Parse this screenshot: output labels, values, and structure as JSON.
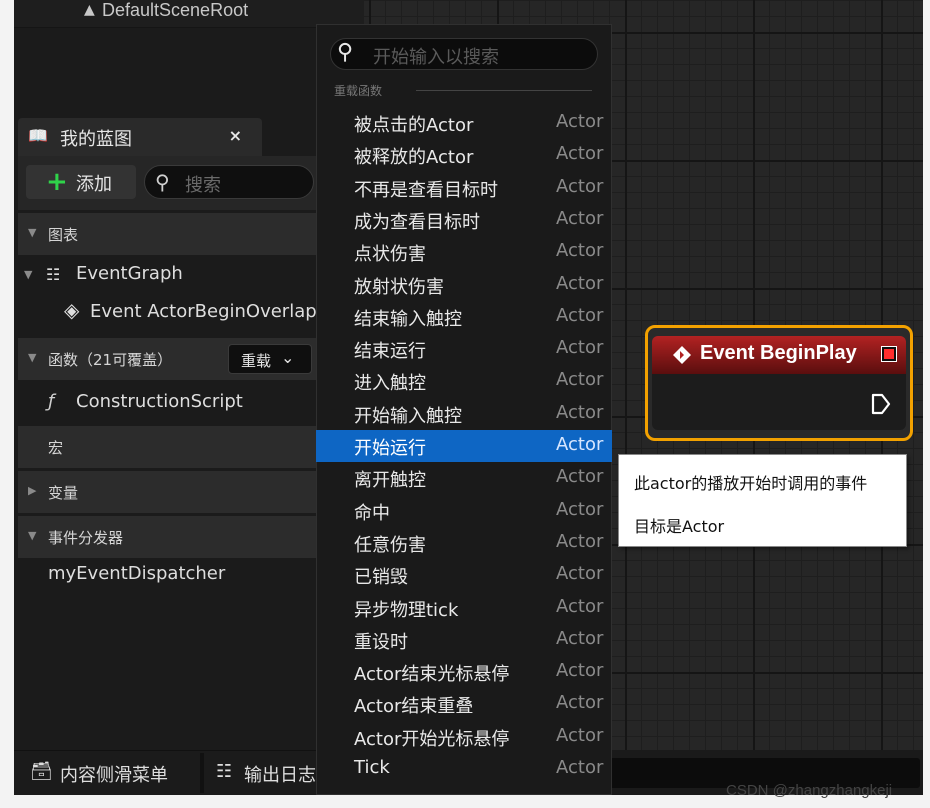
{
  "scene": {
    "root_label": "DefaultSceneRoot"
  },
  "blueprint_panel": {
    "tab_title": "我的蓝图",
    "tab_close": "×",
    "add_label": "添加",
    "search_placeholder": "搜索",
    "sections": {
      "graphs": "图表",
      "functions": "函数（21可覆盖）",
      "macros": "宏",
      "variables": "变量",
      "dispatchers": "事件分发器"
    },
    "event_graph": "EventGraph",
    "event_overlap": "Event ActorBeginOverlap",
    "reload_label": "重载",
    "construction_script": "ConstructionScript",
    "dispatcher_item": "myEventDispatcher"
  },
  "bottom_bar": {
    "content_drawer": "内容侧滑菜单",
    "output_log": "输出日志"
  },
  "context_menu": {
    "search_placeholder": "开始输入以搜索",
    "category": "重载函数",
    "selected_index": 10,
    "items": [
      {
        "name": "被点击的Actor",
        "class": "Actor"
      },
      {
        "name": "被释放的Actor",
        "class": "Actor"
      },
      {
        "name": "不再是查看目标时",
        "class": "Actor"
      },
      {
        "name": "成为查看目标时",
        "class": "Actor"
      },
      {
        "name": "点状伤害",
        "class": "Actor"
      },
      {
        "name": "放射状伤害",
        "class": "Actor"
      },
      {
        "name": "结束输入触控",
        "class": "Actor"
      },
      {
        "name": "结束运行",
        "class": "Actor"
      },
      {
        "name": "进入触控",
        "class": "Actor"
      },
      {
        "name": "开始输入触控",
        "class": "Actor"
      },
      {
        "name": "开始运行",
        "class": "Actor"
      },
      {
        "name": "离开触控",
        "class": "Actor"
      },
      {
        "name": "命中",
        "class": "Actor"
      },
      {
        "name": "任意伤害",
        "class": "Actor"
      },
      {
        "name": "已销毁",
        "class": "Actor"
      },
      {
        "name": "异步物理tick",
        "class": "Actor"
      },
      {
        "name": "重设时",
        "class": "Actor"
      },
      {
        "name": "Actor结束光标悬停",
        "class": "Actor"
      },
      {
        "name": "Actor结束重叠",
        "class": "Actor"
      },
      {
        "name": "Actor开始光标悬停",
        "class": "Actor"
      },
      {
        "name": "Tick",
        "class": "Actor"
      }
    ]
  },
  "node": {
    "title": "Event BeginPlay"
  },
  "tooltip": {
    "line1": "此actor的播放开始时调用的事件",
    "line2": "目标是Actor"
  },
  "watermark": "CSDN @zhangzhangkeji",
  "colors": {
    "selection": "#0e66c4",
    "node_border": "#f2a100",
    "node_header": "#b22222",
    "add_plus": "#2fd34a"
  }
}
